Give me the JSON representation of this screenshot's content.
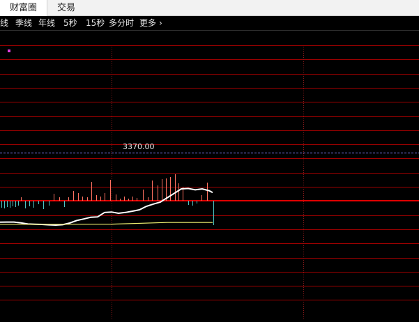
{
  "tabs": [
    {
      "label": "财富圈",
      "active": true
    },
    {
      "label": "交易",
      "active": false
    }
  ],
  "periods": [
    "线",
    "季线",
    "年线",
    "5秒",
    "15秒",
    "多分时",
    "更多"
  ],
  "chart_data": {
    "type": "line",
    "reference_price_label": "3370.00",
    "series": [
      {
        "color": "#ffffff",
        "x": [
          0,
          10,
          20,
          30,
          40,
          50,
          60,
          70,
          80,
          90,
          100,
          110,
          120,
          130,
          140,
          150,
          160,
          170,
          180,
          190,
          200,
          210,
          220,
          230,
          240,
          250,
          260,
          270,
          280,
          290,
          300,
          305
        ],
        "values": [
          0.21,
          0.22,
          0.22,
          0.16,
          0.08,
          0.06,
          0.05,
          0.02,
          0.0,
          0.03,
          0.15,
          0.33,
          0.44,
          0.56,
          0.59,
          0.91,
          0.94,
          0.85,
          0.91,
          1.0,
          1.1,
          1.35,
          1.51,
          1.65,
          1.97,
          2.28,
          2.6,
          2.63,
          2.53,
          2.6,
          2.47,
          2.34
        ]
      },
      {
        "color": "#f0f070",
        "x": [
          0,
          80,
          160,
          240,
          305
        ],
        "values": [
          0.06,
          0.06,
          0.07,
          0.19,
          0.19
        ]
      }
    ],
    "volume_bars": [
      {
        "x": 2,
        "v": -0.5
      },
      {
        "x": 6,
        "v": -0.55
      },
      {
        "x": 10,
        "v": -0.45
      },
      {
        "x": 14,
        "v": -0.5
      },
      {
        "x": 18,
        "v": -0.4
      },
      {
        "x": 22,
        "v": -0.45
      },
      {
        "x": 26,
        "v": -0.35
      },
      {
        "x": 30,
        "v": 0.25
      },
      {
        "x": 36,
        "v": -0.55
      },
      {
        "x": 42,
        "v": -0.4
      },
      {
        "x": 48,
        "v": -0.5
      },
      {
        "x": 55,
        "v": -0.25
      },
      {
        "x": 62,
        "v": -0.6
      },
      {
        "x": 70,
        "v": -0.35
      },
      {
        "x": 77,
        "v": 0.5
      },
      {
        "x": 85,
        "v": 0.25
      },
      {
        "x": 92,
        "v": -0.45
      },
      {
        "x": 98,
        "v": 0.25
      },
      {
        "x": 105,
        "v": 0.7
      },
      {
        "x": 112,
        "v": 0.55
      },
      {
        "x": 118,
        "v": 0.3
      },
      {
        "x": 125,
        "v": 0.25
      },
      {
        "x": 131,
        "v": 1.35
      },
      {
        "x": 138,
        "v": 0.4
      },
      {
        "x": 144,
        "v": 0.3
      },
      {
        "x": 150,
        "v": 0.55
      },
      {
        "x": 158,
        "v": 1.5
      },
      {
        "x": 166,
        "v": 0.45
      },
      {
        "x": 172,
        "v": 0.15
      },
      {
        "x": 178,
        "v": 0.3
      },
      {
        "x": 184,
        "v": 0.15
      },
      {
        "x": 190,
        "v": 0.3
      },
      {
        "x": 196,
        "v": 0.2
      },
      {
        "x": 205,
        "v": 0.8
      },
      {
        "x": 212,
        "v": 0.25
      },
      {
        "x": 218,
        "v": 1.45
      },
      {
        "x": 226,
        "v": 1.1
      },
      {
        "x": 232,
        "v": 1.55
      },
      {
        "x": 238,
        "v": 1.6
      },
      {
        "x": 244,
        "v": 1.7
      },
      {
        "x": 251,
        "v": 1.9
      },
      {
        "x": 256,
        "v": 1.25
      },
      {
        "x": 262,
        "v": 1.0
      },
      {
        "x": 270,
        "v": -0.3
      },
      {
        "x": 276,
        "v": -0.35
      },
      {
        "x": 282,
        "v": -0.2
      },
      {
        "x": 289,
        "v": 0.4
      },
      {
        "x": 297,
        "v": 1.3
      },
      {
        "x": 306,
        "v": -1.75
      }
    ],
    "colors": {
      "background": "#000000",
      "grid_h": "#a00000",
      "grid_v": "#8a1a1a",
      "zero_line": "#e00000",
      "up_bar": "#ff7060",
      "down_bar": "#4cc4c4",
      "reference_line": "#8080ff",
      "marker": "#e040e0"
    }
  }
}
